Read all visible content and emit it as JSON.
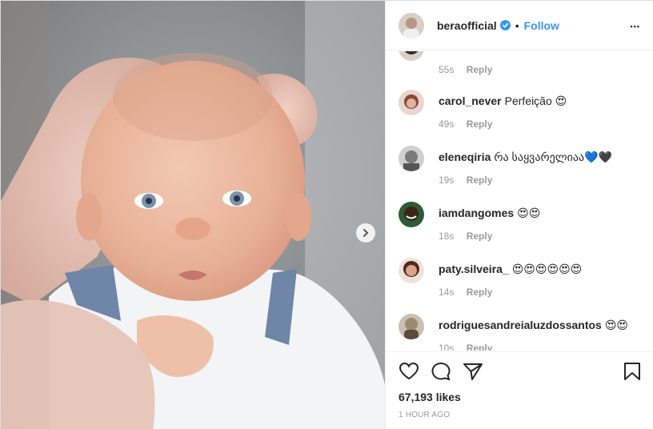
{
  "post": {
    "author": {
      "username": "beraofficial",
      "verified": true,
      "dot": "•",
      "follow_label": "Follow",
      "more_label": "•••"
    },
    "image_alt": "baby photo",
    "next_icon": "chevron-right-icon"
  },
  "comments": [
    {
      "username": "",
      "text": "",
      "age": "55s",
      "reply": "Reply",
      "avatar_color": "#3a2a22"
    },
    {
      "username": "carol_never",
      "text": "Perfeição 😍",
      "age": "49s",
      "reply": "Reply",
      "avatar_color": "#8a4a3a"
    },
    {
      "username": "eleneqiria",
      "text": "რა საყვარელიაა💙🖤",
      "age": "19s",
      "reply": "Reply",
      "avatar_color": "#7a7a7a"
    },
    {
      "username": "iamdangomes",
      "text": "😍😍",
      "age": "18s",
      "reply": "Reply",
      "avatar_color": "#3a2618"
    },
    {
      "username": "paty.silveira_",
      "text": "😍😍😍😍😍😍",
      "age": "14s",
      "reply": "Reply",
      "avatar_color": "#b08070"
    },
    {
      "username": "rodriguesandreialuzdossantos",
      "text": "😍😍",
      "age": "10s",
      "reply": "Reply",
      "avatar_color": "#9a8a72"
    }
  ],
  "actions": {
    "likes": "67,193 likes",
    "time": "1 HOUR AGO",
    "icons": [
      "heart-icon",
      "comment-icon",
      "share-icon",
      "bookmark-icon"
    ]
  },
  "colors": {
    "accent": "#3897f0",
    "muted": "#999999",
    "border": "#efefef"
  }
}
